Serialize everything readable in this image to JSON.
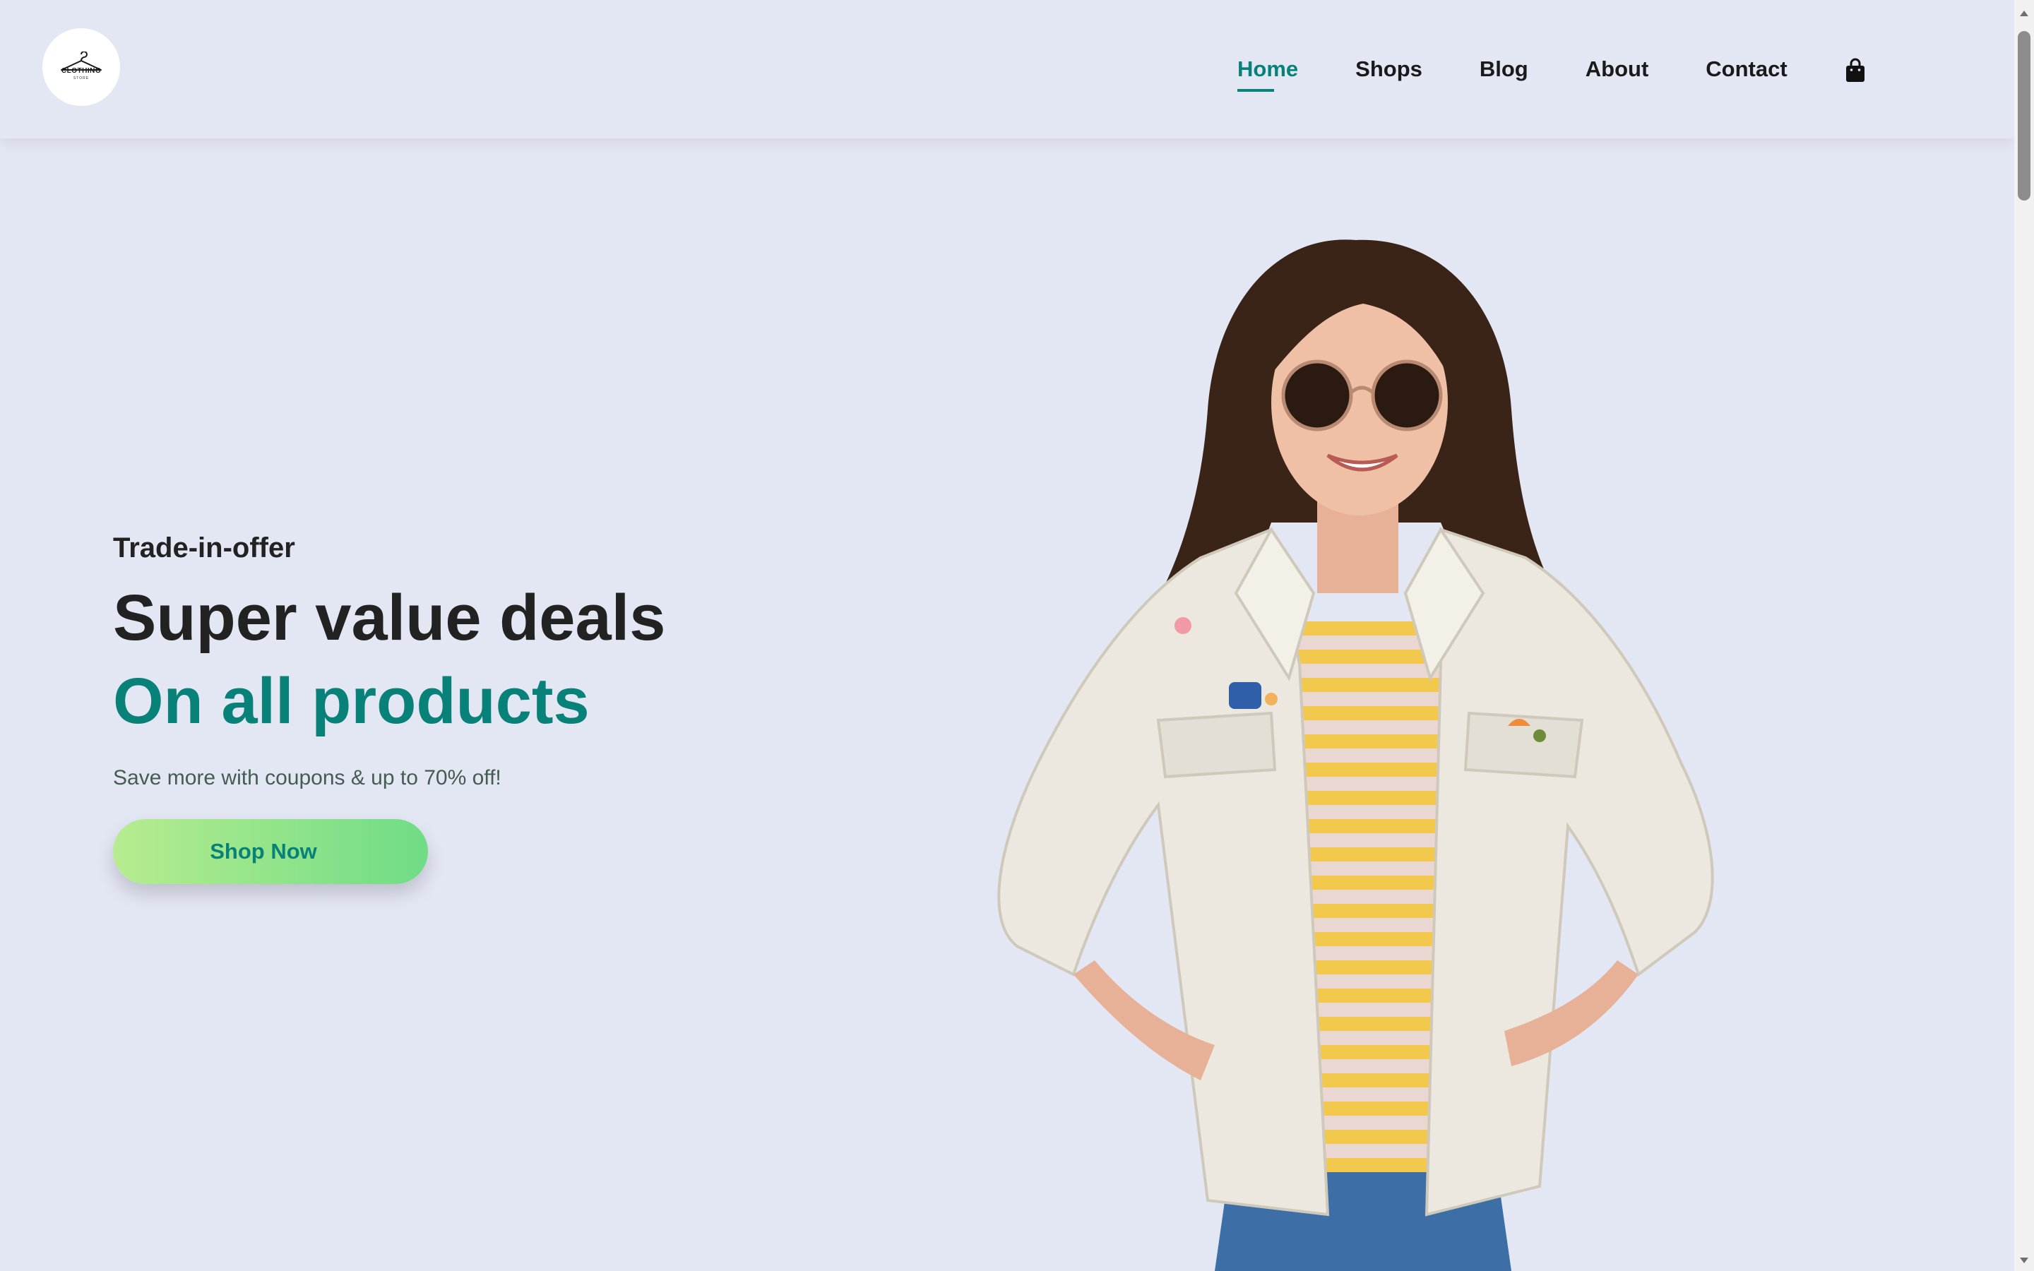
{
  "logo": {
    "text": "CLOTHING",
    "sub": "STORE"
  },
  "nav": {
    "items": [
      {
        "label": "Home",
        "active": true
      },
      {
        "label": "Shops",
        "active": false
      },
      {
        "label": "Blog",
        "active": false
      },
      {
        "label": "About",
        "active": false
      },
      {
        "label": "Contact",
        "active": false
      }
    ],
    "cart_icon": "shopping-bag-icon"
  },
  "hero": {
    "eyebrow": "Trade-in-offer",
    "title_line1": "Super value deals",
    "title_line2": "On all products",
    "subtitle": "Save more with coupons & up to 70% off!",
    "cta_label": "Shop Now",
    "image": "woman-white-jacket-sunglasses"
  },
  "colors": {
    "background": "#e3e6f3",
    "accent": "#088178",
    "text": "#222222",
    "cta_gradient_start": "#b7ec8f",
    "cta_gradient_end": "#6fdc86"
  }
}
